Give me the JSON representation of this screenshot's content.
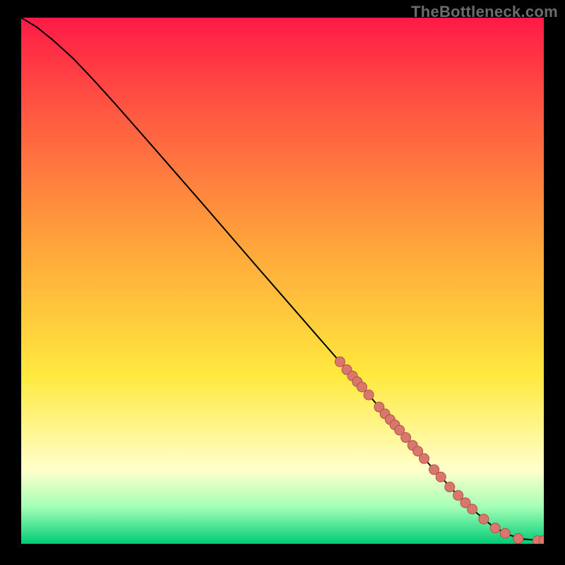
{
  "watermark": "TheBottleneck.com",
  "colors": {
    "black": "#000000",
    "red_top": "#ff1a46",
    "red_mid": "#ff5842",
    "orange": "#ffa13b",
    "yellow": "#ffe93d",
    "pale_yellow": "#ffffcc",
    "mint": "#a4ffb6",
    "green_deep": "#00cc76",
    "curve_stroke": "#000000",
    "point_fill": "#d8786d",
    "point_stroke": "#b54f49"
  },
  "chart_data": {
    "type": "line",
    "title": "",
    "xlabel": "",
    "ylabel": "",
    "xlim": [
      0,
      100
    ],
    "ylim": [
      0,
      100
    ],
    "curve": [
      {
        "x": 0,
        "y": 100
      },
      {
        "x": 3,
        "y": 98.2
      },
      {
        "x": 6,
        "y": 95.8
      },
      {
        "x": 10,
        "y": 92.2
      },
      {
        "x": 14,
        "y": 88.0
      },
      {
        "x": 18,
        "y": 83.6
      },
      {
        "x": 25,
        "y": 75.7
      },
      {
        "x": 35,
        "y": 64.3
      },
      {
        "x": 45,
        "y": 52.8
      },
      {
        "x": 55,
        "y": 41.4
      },
      {
        "x": 65,
        "y": 30.0
      },
      {
        "x": 72,
        "y": 22.0
      },
      {
        "x": 78,
        "y": 15.2
      },
      {
        "x": 83,
        "y": 9.8
      },
      {
        "x": 87,
        "y": 6.0
      },
      {
        "x": 90,
        "y": 3.5
      },
      {
        "x": 93,
        "y": 1.8
      },
      {
        "x": 96,
        "y": 0.9
      },
      {
        "x": 100,
        "y": 0.6
      }
    ],
    "series": [
      {
        "name": "highlighted-points",
        "points": [
          {
            "x": 61.0,
            "y": 34.6
          },
          {
            "x": 62.3,
            "y": 33.1
          },
          {
            "x": 63.4,
            "y": 31.9
          },
          {
            "x": 64.3,
            "y": 30.8
          },
          {
            "x": 65.2,
            "y": 29.8
          },
          {
            "x": 66.5,
            "y": 28.3
          },
          {
            "x": 68.5,
            "y": 26.0
          },
          {
            "x": 69.6,
            "y": 24.7
          },
          {
            "x": 70.6,
            "y": 23.6
          },
          {
            "x": 71.5,
            "y": 22.6
          },
          {
            "x": 72.4,
            "y": 21.6
          },
          {
            "x": 73.6,
            "y": 20.2
          },
          {
            "x": 74.9,
            "y": 18.7
          },
          {
            "x": 75.9,
            "y": 17.6
          },
          {
            "x": 77.1,
            "y": 16.2
          },
          {
            "x": 79.0,
            "y": 14.1
          },
          {
            "x": 80.3,
            "y": 12.7
          },
          {
            "x": 82.0,
            "y": 10.8
          },
          {
            "x": 83.6,
            "y": 9.2
          },
          {
            "x": 85.0,
            "y": 7.8
          },
          {
            "x": 86.3,
            "y": 6.6
          },
          {
            "x": 88.5,
            "y": 4.7
          },
          {
            "x": 90.7,
            "y": 3.0
          },
          {
            "x": 92.6,
            "y": 2.0
          },
          {
            "x": 95.1,
            "y": 1.0
          },
          {
            "x": 98.8,
            "y": 0.6
          },
          {
            "x": 100.0,
            "y": 0.6
          }
        ]
      }
    ],
    "gradient_stops": [
      {
        "offset": 0.0,
        "color_key": "red_top"
      },
      {
        "offset": 0.18,
        "color_key": "red_mid"
      },
      {
        "offset": 0.42,
        "color_key": "orange"
      },
      {
        "offset": 0.68,
        "color_key": "yellow"
      },
      {
        "offset": 0.86,
        "color_key": "pale_yellow"
      },
      {
        "offset": 0.93,
        "color_key": "mint"
      },
      {
        "offset": 1.0,
        "color_key": "green_deep"
      }
    ]
  }
}
